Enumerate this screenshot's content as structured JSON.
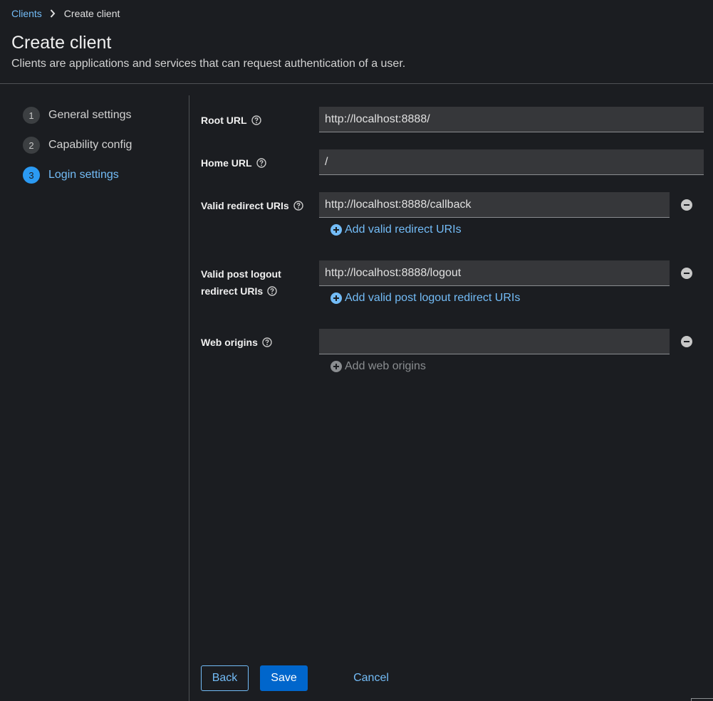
{
  "breadcrumb": {
    "parent": "Clients",
    "current": "Create client"
  },
  "header": {
    "title": "Create client",
    "subtitle": "Clients are applications and services that can request authentication of a user."
  },
  "wizard": {
    "steps": [
      {
        "number": "1",
        "label": "General settings"
      },
      {
        "number": "2",
        "label": "Capability config"
      },
      {
        "number": "3",
        "label": "Login settings"
      }
    ],
    "current_step": "3"
  },
  "form": {
    "root_url": {
      "label": "Root URL",
      "value": "http://localhost:8888/"
    },
    "home_url": {
      "label": "Home URL",
      "value": "/"
    },
    "valid_redirect_uris": {
      "label": "Valid redirect URIs",
      "value": "http://localhost:8888/callback",
      "add_label": "Add valid redirect URIs"
    },
    "valid_post_logout": {
      "label_line1": "Valid post logout",
      "label_line2": "redirect URIs",
      "value": "http://localhost:8888/logout",
      "add_label": "Add valid post logout redirect URIs"
    },
    "web_origins": {
      "label": "Web origins",
      "value": "",
      "add_label": "Add web origins"
    }
  },
  "footer": {
    "back": "Back",
    "save": "Save",
    "cancel": "Cancel"
  },
  "colors": {
    "accent": "#73bcf7",
    "primary": "#0066cc",
    "background": "#1b1d21",
    "input": "#36373a"
  },
  "icons": [
    "chevron-right-icon",
    "help-icon",
    "minus-circle-icon",
    "plus-circle-icon"
  ]
}
